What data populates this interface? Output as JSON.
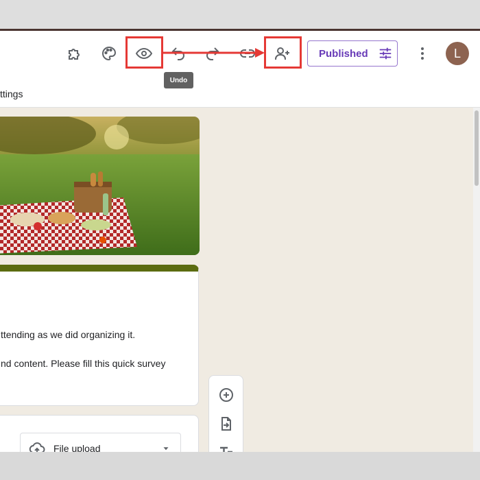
{
  "header": {
    "tooltip": "Undo",
    "publish_label": "Published",
    "avatar_initial": "L",
    "settings_label": "ttings"
  },
  "form": {
    "description_lines": [
      "ttending as we did organizing it.",
      "nd content. Please fill this quick survey"
    ],
    "question_type": "File upload"
  },
  "colors": {
    "accent": "#673ab7",
    "highlight": "#e53935",
    "theme": "#5b6b10"
  }
}
